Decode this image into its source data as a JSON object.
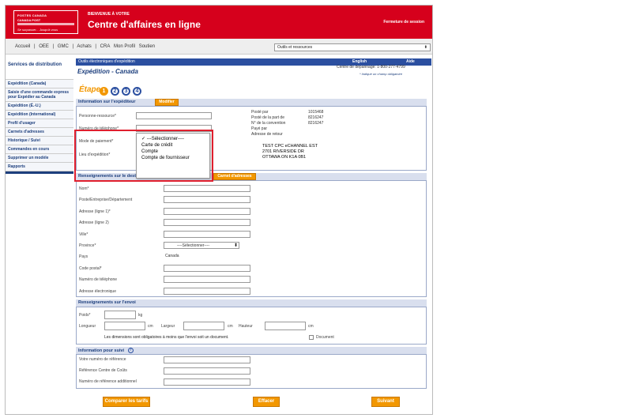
{
  "header": {
    "logo_line1": "POSTES CANADA",
    "logo_line2": "CANADA POST",
    "logo_tagline": "Se surpasser... Jusqu'à vous",
    "welcome": "BIENVENUE À VOTRE",
    "title": "Centre d'affaires en ligne",
    "logout": "Fermeture de session"
  },
  "menu": {
    "items": [
      "Accueil",
      "|",
      "OEE",
      "|",
      "GMC",
      "|",
      "Achats",
      "|",
      "CRA",
      "Mon Profil",
      "Soutien"
    ],
    "tools_label": "Outils et ressources"
  },
  "sidebar": {
    "title": "Services de distribution",
    "items": [
      "Expédition (Canada)",
      "Saisie d'une commande express pour Expédier au Canada",
      "Expédition (É.-U.)",
      "Expédition (International)",
      "Profil d'usager",
      "Carnets d'adresses",
      "Historique / Suivi",
      "Commandes en cours",
      "Supprimer un modèle",
      "Rapports"
    ]
  },
  "topbar": {
    "label": "Outils électroniques d'expédition",
    "english": "English",
    "aide": "Aide"
  },
  "page": {
    "title": "Expédition - Canada",
    "helpdesk": "Centre de dépannage: 1-800-277-4799",
    "mandatory_note": "* Indique un champ obligatoire",
    "step_label": "Étape",
    "steps": [
      "1",
      "2",
      "3",
      "4"
    ]
  },
  "sender": {
    "heading": "Information sur l'expéditeur",
    "modify": "Modifier",
    "contact_label": "Personne-ressource*",
    "phone_label": "Numéro de téléphone*",
    "payment_label": "Mode de paiement*",
    "location_label": "Lieu d'expédition*",
    "info_labels": [
      "Posté par",
      "Posté de la part de",
      "N° de la convention",
      "Payé par",
      "Adresse de retour"
    ],
    "info_values": [
      "1015468",
      "8216247",
      "",
      "8216247",
      ""
    ],
    "return_address": [
      "TEST CPC eCHANNEL EST",
      "2701 RIVERSIDE DR",
      "OTTAWA ON K1A 0B1"
    ]
  },
  "payment_dropdown": {
    "options": [
      "---Sélectionner----",
      "Carte de crédit",
      "Compte",
      "Compte de fournisseur"
    ],
    "selected": "---Sélectionner----"
  },
  "recipient": {
    "heading": "Renseignements sur le destinataire",
    "addressbook_button": "Carnet d'adresses",
    "fields": [
      {
        "label": "Nom*",
        "value": ""
      },
      {
        "label": "Poste/Entreprise/Département",
        "value": ""
      },
      {
        "label": "Adresse (ligne 1)*",
        "value": ""
      },
      {
        "label": "Adresse (ligne 2)",
        "value": ""
      },
      {
        "label": "Ville*",
        "value": ""
      },
      {
        "label": "Province*",
        "value": "----Sélectionner----"
      },
      {
        "label": "Pays",
        "value": "Canada"
      },
      {
        "label": "Code postal*",
        "value": ""
      },
      {
        "label": "Numéro de téléphone",
        "value": ""
      },
      {
        "label": "Adresse électronique",
        "value": ""
      }
    ]
  },
  "shipment": {
    "heading": "Renseignements sur l'envoi",
    "weight_label": "Poids*",
    "weight_unit": "kg",
    "length_label": "Longueur",
    "width_label": "Largeur",
    "height_label": "Hauteur",
    "unit_cm": "cm",
    "dims_note": "Les dimensions sont obligatoires à moins que l'envoi soit un document.",
    "document_label": "Document"
  },
  "tracking": {
    "heading": "Information pour suivi",
    "fields": [
      {
        "label": "Votre numéro de référence"
      },
      {
        "label": "Référence Centre de Coûts"
      },
      {
        "label": "Numéro de référence additionnel"
      }
    ]
  },
  "buttons": {
    "compare": "Comparer les tarifs",
    "clear": "Effacer",
    "next": "Suivant"
  }
}
